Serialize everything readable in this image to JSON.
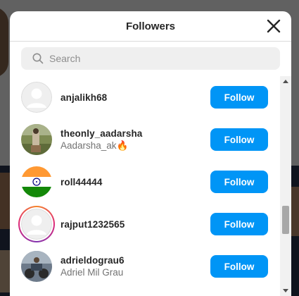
{
  "modal": {
    "title": "Followers",
    "search_placeholder": "Search",
    "close_icon": "close-icon",
    "search_icon": "search-icon"
  },
  "followers": [
    {
      "username": "anjalikh68",
      "fullname": "",
      "avatar": "default-avatar",
      "story_ring": false
    },
    {
      "username": "theonly_aadarsha",
      "fullname": "Aadarsha_ak🔥",
      "avatar": "photo-outdoor",
      "story_ring": false
    },
    {
      "username": "roll44444",
      "fullname": "",
      "avatar": "indian-flag",
      "story_ring": false
    },
    {
      "username": "rajput1232565",
      "fullname": "",
      "avatar": "default-avatar",
      "story_ring": true
    },
    {
      "username": "adrieldograu6",
      "fullname": "Adriel Mil Grau",
      "avatar": "photo-motorbike",
      "story_ring": false
    }
  ],
  "follow_label": "Follow",
  "colors": {
    "follow_button": "#0095f6",
    "primary_text": "#262626",
    "secondary_text": "#737373"
  }
}
